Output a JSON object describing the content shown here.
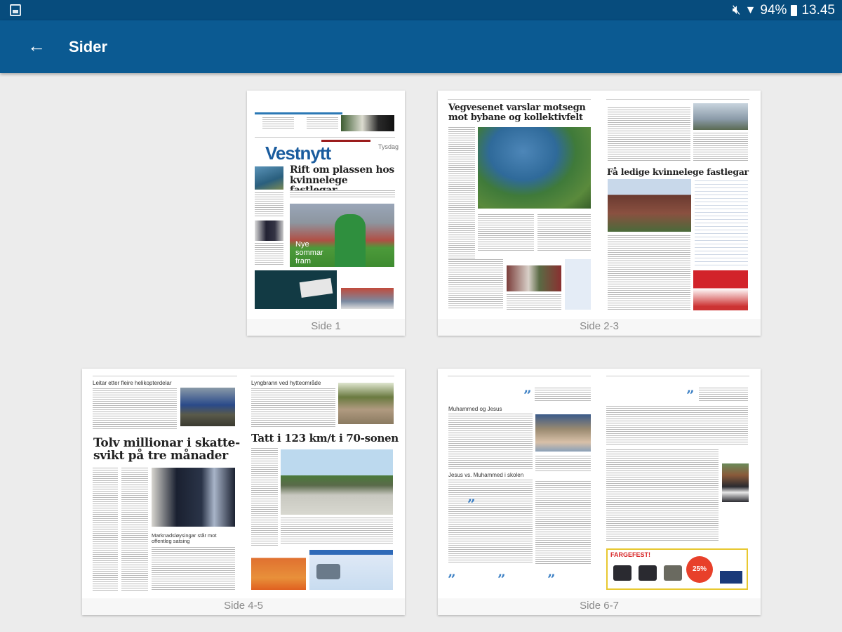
{
  "status_bar": {
    "battery": "94%",
    "time": "13.45",
    "icons": [
      "gallery-icon",
      "mute-icon",
      "wifi-icon",
      "battery-icon"
    ]
  },
  "app_bar": {
    "title": "Sider",
    "back_icon": "arrow-left-icon"
  },
  "colors": {
    "status_bar": "#074c7d",
    "app_bar": "#0b5a92",
    "background": "#ececec",
    "masthead": "#1a5c9e"
  },
  "pages": [
    {
      "label": "Side 1",
      "masthead": "Vestnytt",
      "day": "Tysdag",
      "headline": "Rift om plassen hos kvinnelege fastlegar",
      "photo_caption": "Nye sommar fram"
    },
    {
      "label": "Side 2-3",
      "headline_left": "Vegvesenet varslar motsegn mot bybane og kollektivfelt",
      "headline_right": "Få ledige kvinnelege fastlegar"
    },
    {
      "label": "Side 4-5",
      "headline_top_left": "Leitar etter fleire helikopterdelar",
      "headline_left": "Tolv millionar i skatte-svikt på tre månader",
      "subhead_left": "Marknadsløysingar står mot offentleg satsing",
      "headline_top_right": "Lyngbrann ved hytteområde",
      "headline_right": "Tatt i 123 km/t i 70-sonen"
    },
    {
      "label": "Side 6-7",
      "headline_left": "Muhammed og Jesus",
      "subhead_left": "Jesus vs. Muhammed i skolen",
      "ad_text": "FARGEFEST!",
      "ad_discount": "25%"
    }
  ]
}
